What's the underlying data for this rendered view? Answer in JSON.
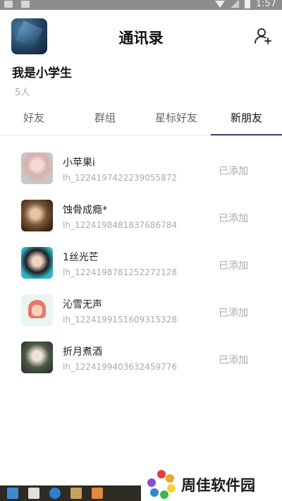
{
  "status_bar": {
    "time": "1:57"
  },
  "header": {
    "title": "通讯录"
  },
  "profile": {
    "name": "我是小学生",
    "member_count": "5人"
  },
  "tabs": [
    {
      "label": "好友",
      "active": false
    },
    {
      "label": "群组",
      "active": false
    },
    {
      "label": "星标好友",
      "active": false
    },
    {
      "label": "新朋友",
      "active": true
    }
  ],
  "friends": [
    {
      "name": "小苹果i",
      "id": "lh_1224197422239055872",
      "status": "已添加"
    },
    {
      "name": "蚀骨成瘾*",
      "id": "lh_1224198481837686784",
      "status": "已添加"
    },
    {
      "name": "1丝光芒",
      "id": "lh_1224198781252272128",
      "status": "已添加"
    },
    {
      "name": "沁雪无声",
      "id": "lh_1224199151609315328",
      "status": "已添加"
    },
    {
      "name": "折月煮酒",
      "id": "lh_1224199403632459776",
      "status": "已添加"
    }
  ],
  "watermark": {
    "text": "周佳软件园"
  },
  "colors": {
    "tab_indicator": "#3a3f63",
    "muted_text": "#aaaaaa",
    "primary_text": "#111111"
  }
}
